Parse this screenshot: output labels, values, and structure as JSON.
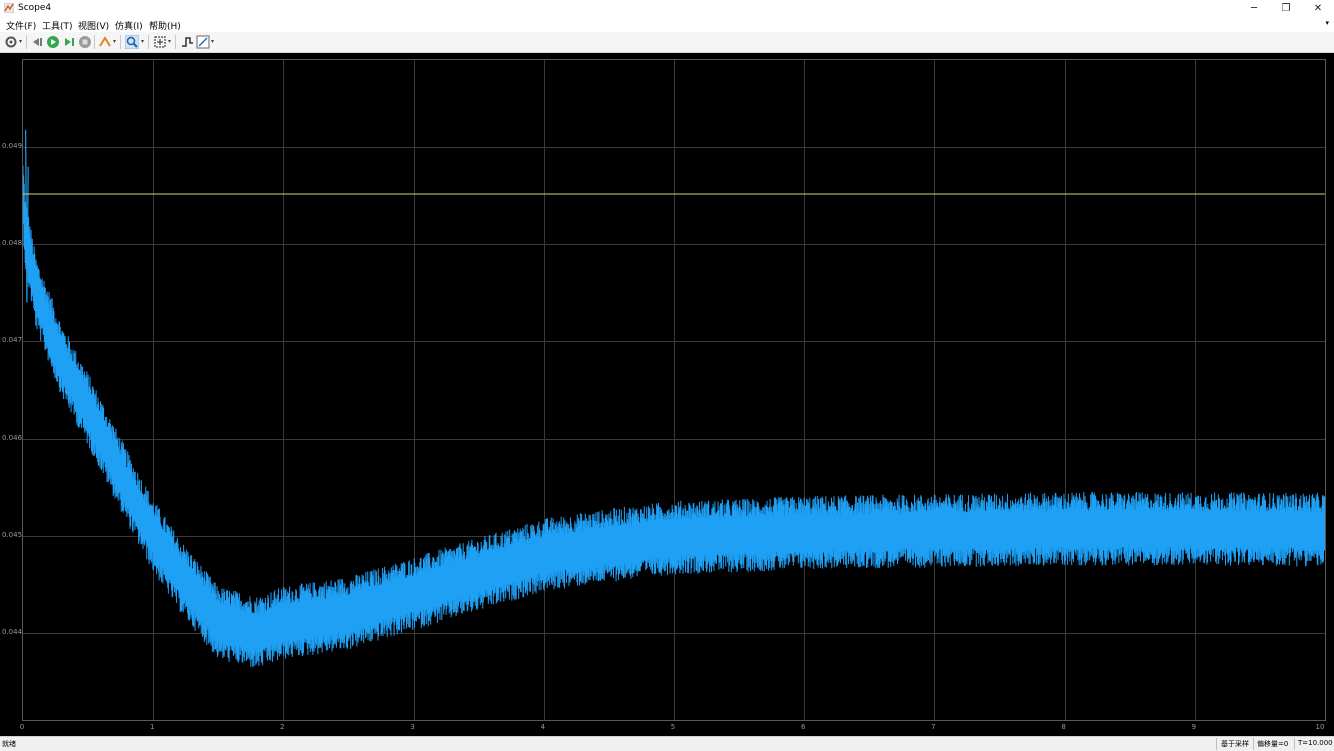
{
  "window": {
    "title": "Scope4",
    "icon": "matlab-scope-icon"
  },
  "window_controls": {
    "minimize": "─",
    "restore": "❐",
    "close": "✕"
  },
  "menu": [
    "文件(F)",
    "工具(T)",
    "视图(V)",
    "仿真(I)",
    "帮助(H)"
  ],
  "toolbar": {
    "buttons": [
      "settings-icon",
      "step-back-icon",
      "run-icon",
      "step-forward-icon",
      "stop-icon",
      "highlight-icon",
      "zoom-icon",
      "autoscale-icon",
      "triggers-icon",
      "measurements-icon"
    ]
  },
  "colors": {
    "signal": "#1ea0f5",
    "reference": "#d6d27a",
    "plot_bg": "#000000",
    "grid": "#3a3a3a"
  },
  "chart_data": {
    "type": "line",
    "title": "",
    "xlabel": "",
    "ylabel": "",
    "xlim": [
      0,
      10
    ],
    "ylim": [
      0.0431,
      0.0499
    ],
    "grid": true,
    "x_ticks": [
      "0",
      "1",
      "2",
      "3",
      "4",
      "5",
      "6",
      "7",
      "8",
      "9",
      "10"
    ],
    "y_ticks": [
      "0.044",
      "0.045",
      "0.046",
      "0.047",
      "0.048",
      "0.049"
    ],
    "series": [
      {
        "color": "#1ea0f5",
        "x": [
          0,
          0.02,
          0.1,
          0.3,
          0.5,
          0.8,
          1.0,
          1.2,
          1.5,
          1.8,
          2.0,
          2.5,
          3.0,
          3.5,
          4.0,
          4.5,
          5.0,
          5.5,
          6.0,
          7.0,
          8.0,
          9.0,
          10.0
        ],
        "center": [
          0.0485,
          0.0481,
          0.0475,
          0.0468,
          0.0463,
          0.0455,
          0.045,
          0.0446,
          0.0441,
          0.044,
          0.0441,
          0.0442,
          0.0444,
          0.0446,
          0.0448,
          0.0449,
          0.04498,
          0.045,
          0.04503,
          0.04505,
          0.04507,
          0.04507,
          0.04506
        ],
        "band_half_width": 0.00033
      },
      {
        "color": "#d6d27a",
        "x": [
          0,
          10
        ],
        "values": [
          0.04852,
          0.04852
        ]
      }
    ]
  },
  "status": {
    "left": "就绪",
    "sample_mode": "基于采样",
    "offset": "偏移量=0",
    "time": "T=10.000"
  }
}
